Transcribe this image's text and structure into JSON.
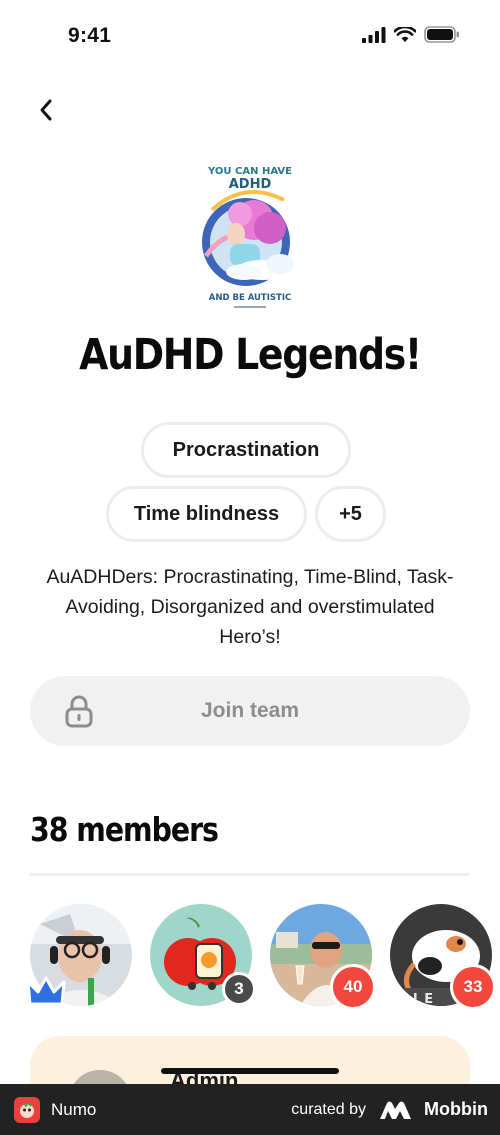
{
  "status_bar": {
    "time": "9:41"
  },
  "team": {
    "logo_text_top": "YOU CAN HAVE",
    "logo_text_mid": "ADHD",
    "logo_text_bottom": "AND BE AUTISTIC",
    "title": "AuDHD Legends!",
    "tags": [
      "Procrastination",
      "Time blindness",
      "+5"
    ],
    "description": "AuADHDers: Procrastinating, Time-Blind, Task-Avoiding, Disorganized and overstimulated Hero’s!",
    "join_label": "Join team"
  },
  "members": {
    "title": "38 members",
    "list": [
      {
        "badge": "",
        "badge_type": "crown"
      },
      {
        "badge": "3",
        "badge_type": "dark"
      },
      {
        "badge": "40",
        "badge_type": "red"
      },
      {
        "badge": "33",
        "badge_type": "red",
        "shirt_text": "BLE"
      }
    ],
    "admin_label": "Admin"
  },
  "colors": {
    "badge_red": "#f2463f",
    "badge_dark": "#4a4a4a",
    "crown_blue": "#2f6fe0",
    "admin_card_bg": "#fdf0dd",
    "join_bg": "#f1f1f1"
  },
  "footer": {
    "app_name": "Numo",
    "curated_by": "curated by",
    "brand": "Mobbin"
  }
}
